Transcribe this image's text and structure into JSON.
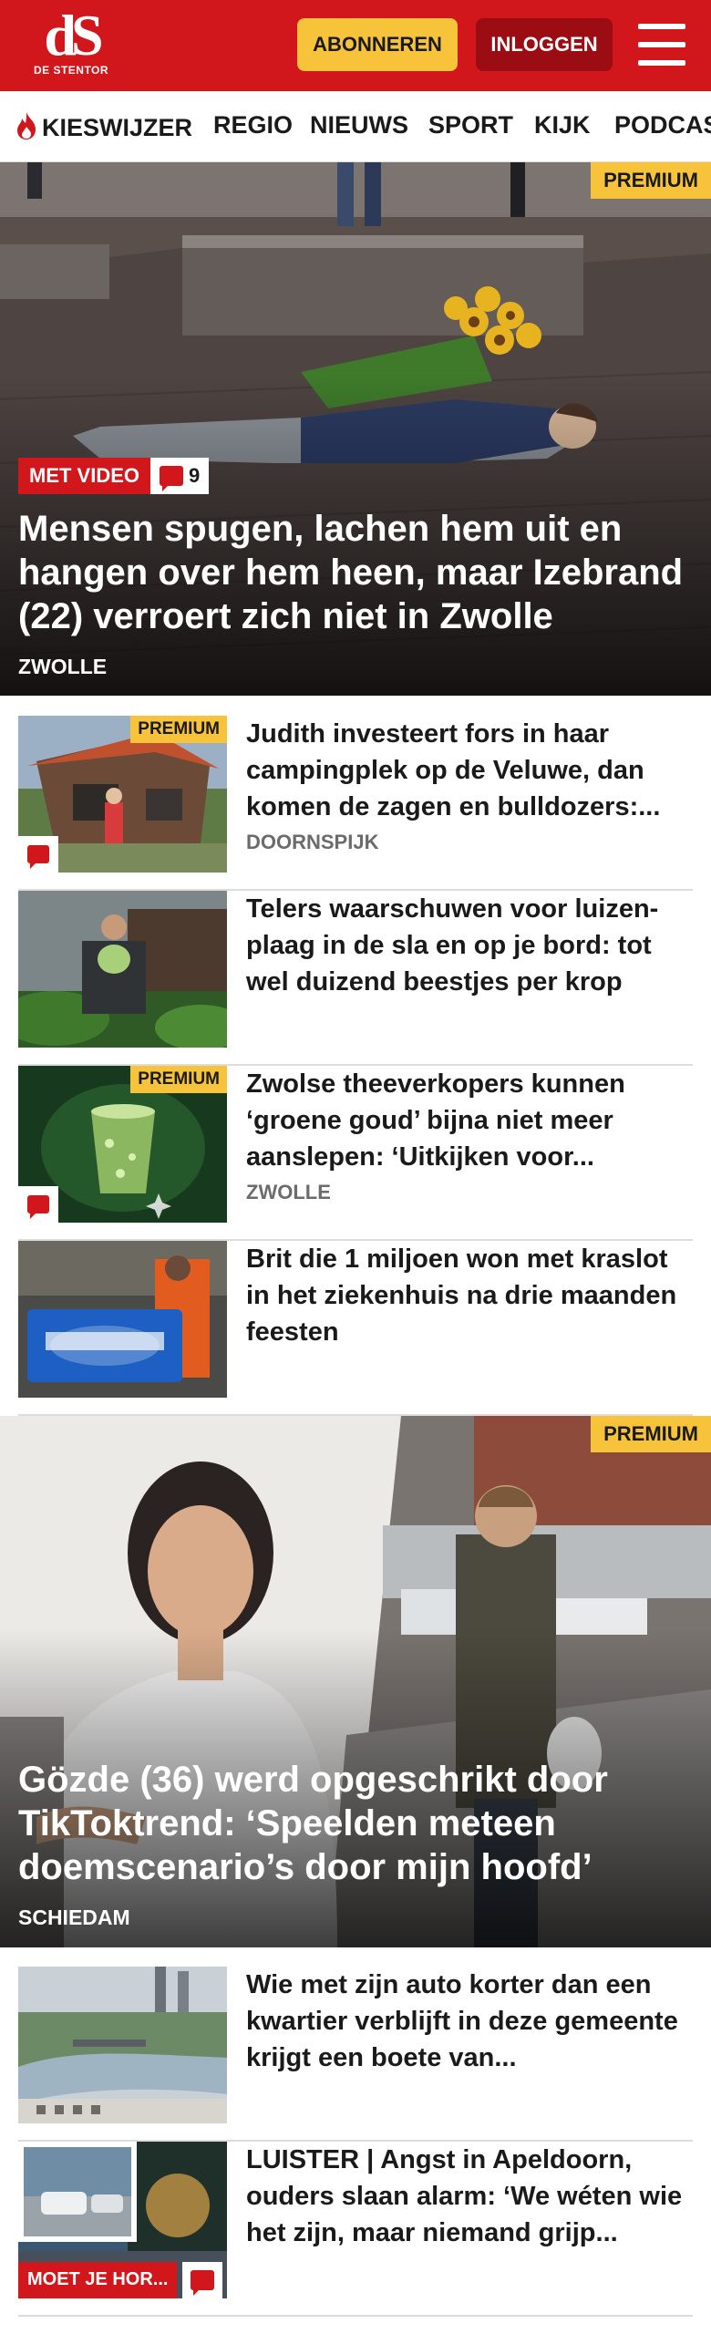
{
  "header": {
    "logo_text": "dS",
    "logo_subtitle": "DE STENTOR",
    "subscribe_label": "ABONNEREN",
    "login_label": "INLOGGEN",
    "brand_color": "#d1171b",
    "accent_color": "#f7c33b"
  },
  "nav": {
    "items": [
      "KIESWIJZER",
      "REGIO",
      "NIEUWS",
      "SPORT",
      "KIJK",
      "PODCAST"
    ]
  },
  "hero1": {
    "premium": "PREMIUM",
    "video_badge": "MET VIDEO",
    "comment_count": "9",
    "title": "Mensen spugen, lachen hem uit en hangen over hem heen, maar Izebrand (22) verroert zich niet in Zwolle",
    "location": "ZWOLLE"
  },
  "articles1": [
    {
      "premium": "PREMIUM",
      "title": "Judith investeert fors in haar campingplek op de Veluwe, dan komen de zagen en bulldozers:...",
      "location": "DOORNSPIJK",
      "icon": "comment-icon"
    },
    {
      "title": "Telers waarschuwen voor luizen­plaag in de sla en op je bord: tot wel duizend beestjes per krop"
    },
    {
      "premium": "PREMIUM",
      "title": "Zwolse theeverkopers kunnen ‘groene goud’ bijna niet meer aanslepen: ‘Uitkijken voor...",
      "location": "ZWOLLE",
      "icon": "comment-icon"
    },
    {
      "title": "Brit die 1 miljoen won met kraslot in het ziekenhuis na drie maanden feesten"
    }
  ],
  "hero2": {
    "premium": "PREMIUM",
    "title": "Gözde (36) werd opgeschrikt door TikToktrend: ‘Speelden meteen doemscenario’s door mijn hoofd’",
    "location": "SCHIEDAM"
  },
  "articles2": [
    {
      "title": "Wie met zijn auto korter dan een kwartier verblijft in deze gemeente krijgt een boete van..."
    },
    {
      "title": "LUISTER | Angst in Apeldoorn, ouders slaan alarm: ‘We wéten wie het zijn, maar niemand grijp...",
      "label": "MOET JE HOR...",
      "icon": "comment-icon"
    }
  ]
}
